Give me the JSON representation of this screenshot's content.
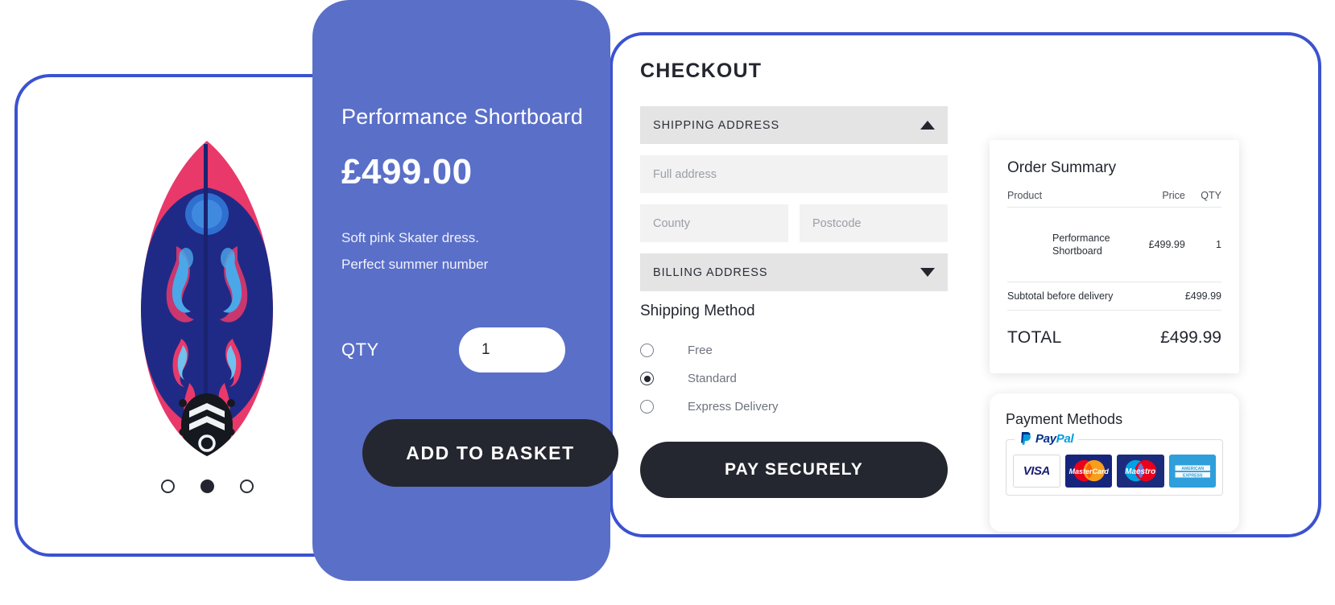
{
  "product": {
    "title": "Performance Shortboard",
    "price": "£499.00",
    "description_line1": "Soft pink Skater dress.",
    "description_line2": "Perfect summer number",
    "qty_label": "QTY",
    "qty_value": "1",
    "add_to_basket_label": "ADD TO BASKET",
    "carousel": {
      "total": 3,
      "active_index": 1
    },
    "image_alt": "pink and blue surfboard with tribal flame graphics"
  },
  "checkout": {
    "title": "CHECKOUT",
    "shipping_address": {
      "label": "SHIPPING ADDRESS",
      "expanded": true,
      "icon": "triangle-up-icon"
    },
    "billing_address": {
      "label": "BILLING ADDRESS",
      "expanded": false,
      "icon": "triangle-down-icon"
    },
    "fields": {
      "full_address": {
        "placeholder": "Full address",
        "value": ""
      },
      "county": {
        "placeholder": "County",
        "value": ""
      },
      "postcode": {
        "placeholder": "Postcode",
        "value": ""
      }
    },
    "shipping_method": {
      "title": "Shipping Method",
      "options": [
        {
          "label": "Free",
          "selected": false
        },
        {
          "label": "Standard",
          "selected": true
        },
        {
          "label": "Express Delivery",
          "selected": false
        }
      ]
    },
    "pay_button_label": "PAY SECURELY"
  },
  "order_summary": {
    "title": "Order Summary",
    "columns": [
      "Product",
      "Price",
      "QTY"
    ],
    "rows": [
      {
        "product": "Performance Shortboard",
        "price": "£499.99",
        "qty": "1"
      }
    ],
    "subtotal_label": "Subtotal before delivery",
    "subtotal_value": "£499.99",
    "total_label": "TOTAL",
    "total_value": "£499.99"
  },
  "payment_methods": {
    "title": "Payment Methods",
    "paypal": {
      "part1": "Pay",
      "part2": "Pal",
      "icon": "paypal-icon"
    },
    "cards": [
      {
        "name": "VISA",
        "icon": "visa-icon"
      },
      {
        "name": "MasterCard",
        "icon": "mastercard-icon"
      },
      {
        "name": "Maestro",
        "icon": "maestro-icon"
      },
      {
        "name": "AMERICAN EXPRESS",
        "icon": "amex-icon"
      }
    ]
  },
  "colors": {
    "brand_blue": "#5a6fc8",
    "outline_blue": "#3b52d0",
    "dark_button": "#24272f",
    "field_gray": "#f2f2f2",
    "header_gray": "#e4e4e4"
  }
}
